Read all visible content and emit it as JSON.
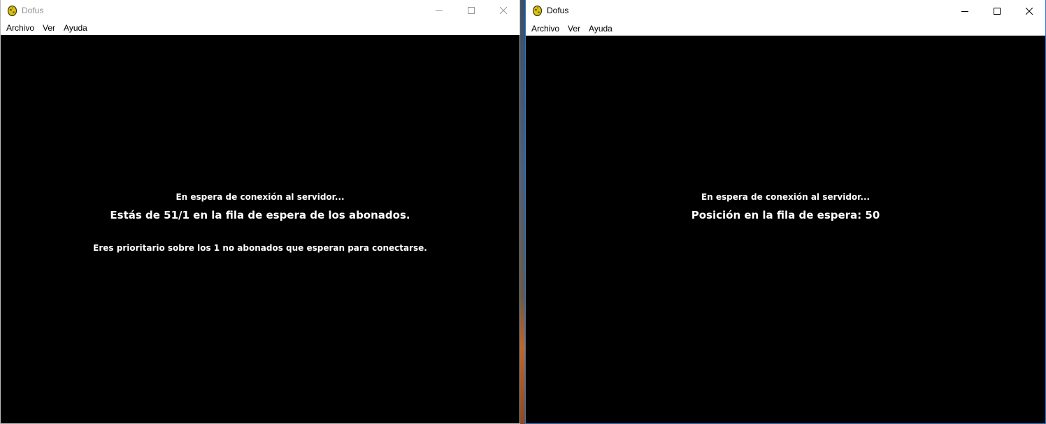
{
  "left_window": {
    "title": "Dofus",
    "menu": [
      "Archivo",
      "Ver",
      "Ayuda"
    ],
    "waiting_text": "En espera de conexión al servidor...",
    "queue_text": "Estás de 51/1 en la fila de espera de los abonados.",
    "priority_text": "Eres prioritario sobre los 1 no abonados que esperan para conectarse."
  },
  "right_window": {
    "title": "Dofus",
    "menu": [
      "Archivo",
      "Ver",
      "Ayuda"
    ],
    "waiting_text": "En espera de conexión al servidor...",
    "queue_text": "Posición en la fila de espera: 50"
  },
  "icons": {
    "app": "dofus-egg-icon",
    "minimize": "minimize-icon",
    "maximize": "maximize-icon",
    "close": "close-icon"
  },
  "colors": {
    "content_bg": "#000000",
    "content_text": "#ffffff",
    "inactive_title": "#8f8f8f",
    "active_border": "#2b79d0",
    "egg_icon": "#d9c21a"
  }
}
